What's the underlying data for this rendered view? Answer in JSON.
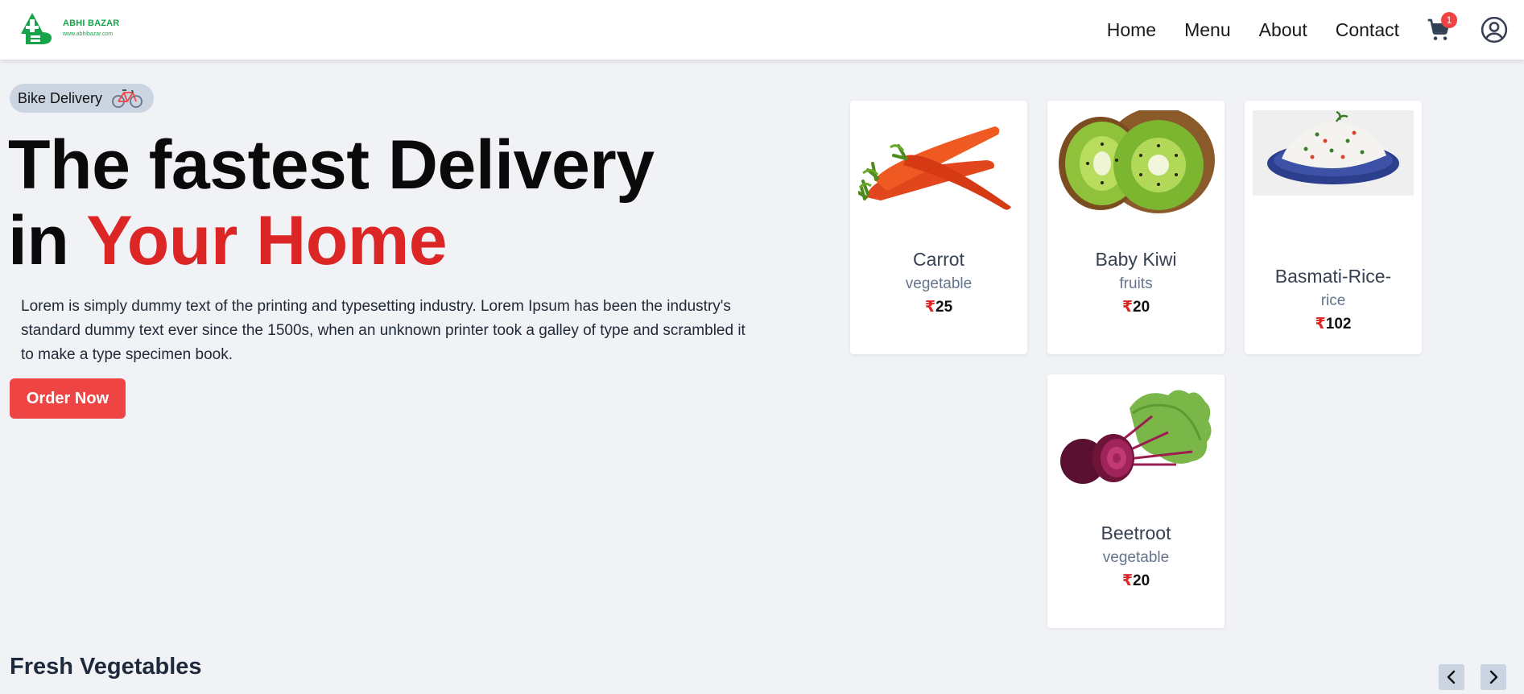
{
  "header": {
    "logo": {
      "brand": "ABHI BAZAR",
      "url": "www.abhibazar.com",
      "color": "#16a34a"
    },
    "nav": [
      "Home",
      "Menu",
      "About",
      "Contact"
    ],
    "cart_count": "1",
    "icons": [
      "cart-icon",
      "user-icon"
    ]
  },
  "hero": {
    "badge": {
      "label": "Bike Delivery",
      "icon": "bicycle-icon"
    },
    "headline_line1": "The fastest Delivery",
    "headline_in": "in",
    "headline_accent": "Your Home",
    "accent_color": "#dc2626",
    "description": "Lorem is simply dummy text of the printing and typesetting industry. Lorem Ipsum has been the industry's standard dummy text ever since the 1500s, when an unknown printer took a galley of type and scrambled it to make a type specimen book.",
    "cta": "Order Now"
  },
  "products": [
    {
      "name": "Carrot",
      "category": "vegetable",
      "currency": "₹",
      "price": "25",
      "image": "carrot"
    },
    {
      "name": "Baby Kiwi",
      "category": "fruits",
      "currency": "₹",
      "price": "20",
      "image": "kiwi"
    },
    {
      "name": "Basmati-Rice-",
      "category": "rice",
      "currency": "₹",
      "price": "102",
      "image": "rice"
    },
    {
      "name": "Beetroot",
      "category": "vegetable",
      "currency": "₹",
      "price": "20",
      "image": "beetroot"
    }
  ],
  "section": {
    "title": "Fresh Vegetables"
  }
}
